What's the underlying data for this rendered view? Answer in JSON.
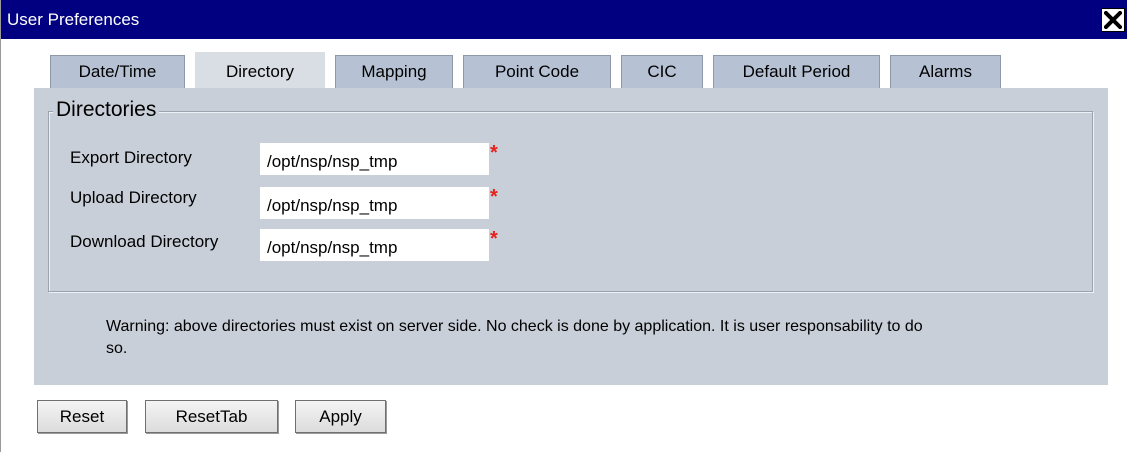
{
  "window": {
    "title": "User Preferences"
  },
  "tabs": [
    {
      "label": "Date/Time",
      "active": false
    },
    {
      "label": "Directory",
      "active": true
    },
    {
      "label": "Mapping",
      "active": false
    },
    {
      "label": "Point Code",
      "active": false
    },
    {
      "label": "CIC",
      "active": false
    },
    {
      "label": "Default Period",
      "active": false
    },
    {
      "label": "Alarms",
      "active": false
    }
  ],
  "directories": {
    "legend": "Directories",
    "required_marker": "*",
    "fields": [
      {
        "label": "Export Directory",
        "value": "/opt/nsp/nsp_tmp"
      },
      {
        "label": "Upload Directory",
        "value": "/opt/nsp/nsp_tmp"
      },
      {
        "label": "Download Directory",
        "value": "/opt/nsp/nsp_tmp"
      }
    ]
  },
  "warning": "Warning: above directories must exist on server side. No check is done by application. It is user responsability to do so.",
  "buttons": {
    "reset": "Reset",
    "reset_tab": "ResetTab",
    "apply": "Apply"
  },
  "colors": {
    "titlebar": "#000080",
    "panel": "#c9cfd9",
    "tab_inactive": "#b6c2d4",
    "required": "#e8201c"
  },
  "icons": {
    "close": "close-x-icon"
  }
}
